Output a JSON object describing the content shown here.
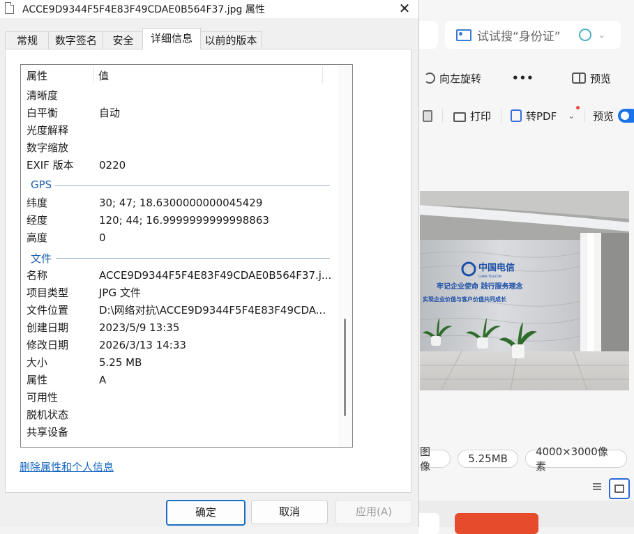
{
  "dialog": {
    "title": "ACCE9D9344F5F4E83F49CDAE0B564F37.jpg 属性",
    "tabs": [
      {
        "label": "常规"
      },
      {
        "label": "数字签名"
      },
      {
        "label": "安全"
      },
      {
        "label": "详细信息",
        "active": true
      },
      {
        "label": "以前的版本"
      }
    ],
    "list": {
      "header": {
        "col1": "属性",
        "col2": "值"
      },
      "rows_top": [
        {
          "k": "清晰度",
          "v": ""
        },
        {
          "k": "白平衡",
          "v": "自动"
        },
        {
          "k": "光度解释",
          "v": ""
        },
        {
          "k": "数字缩放",
          "v": ""
        },
        {
          "k": "EXIF 版本",
          "v": "0220"
        }
      ],
      "group_gps": "GPS",
      "rows_gps": [
        {
          "k": "纬度",
          "v": "30; 47; 18.6300000000045429"
        },
        {
          "k": "经度",
          "v": "120; 44; 16.9999999999998863"
        },
        {
          "k": "高度",
          "v": "0"
        }
      ],
      "group_file": "文件",
      "rows_file": [
        {
          "k": "名称",
          "v": "ACCE9D9344F5F4E83F49CDAE0B564F37.j..."
        },
        {
          "k": "项目类型",
          "v": "JPG 文件"
        },
        {
          "k": "文件位置",
          "v": "D:\\网络对抗\\ACCE9D9344F5F4E83F49CDA..."
        },
        {
          "k": "创建日期",
          "v": "2023/5/9 13:35"
        },
        {
          "k": "修改日期",
          "v": "2026/3/13 14:33"
        },
        {
          "k": "大小",
          "v": "5.25 MB"
        },
        {
          "k": "属性",
          "v": "A"
        },
        {
          "k": "可用性",
          "v": ""
        },
        {
          "k": "脱机状态",
          "v": ""
        },
        {
          "k": "共享设备",
          "v": ""
        }
      ]
    },
    "remove_link": "删除属性和个人信息",
    "buttons": {
      "ok": "确定",
      "cancel": "取消",
      "apply": "应用(A)"
    }
  },
  "background_app": {
    "search_text": "试试搜“身份证”",
    "toolbar1": {
      "rotate_left": "向左旋转",
      "more": "•••",
      "preview": "预览"
    },
    "toolbar2": {
      "print": "打印",
      "to_pdf": "转PDF",
      "preview": "预览"
    },
    "photo_sign": {
      "brand_cn": "中国电信",
      "brand_en": "CHINA TELECOM",
      "line1": "牢记企业使命   践行服务理念",
      "line2": "实现企业价值与客户价值共同成长"
    },
    "chips": {
      "type": "图像",
      "size": "5.25MB",
      "dims": "4000×3000像素"
    }
  },
  "colors": {
    "accent": "#1a6fc4",
    "link": "#1565c0",
    "group": "#1f5fb0",
    "red_button": "#e64c2c"
  }
}
